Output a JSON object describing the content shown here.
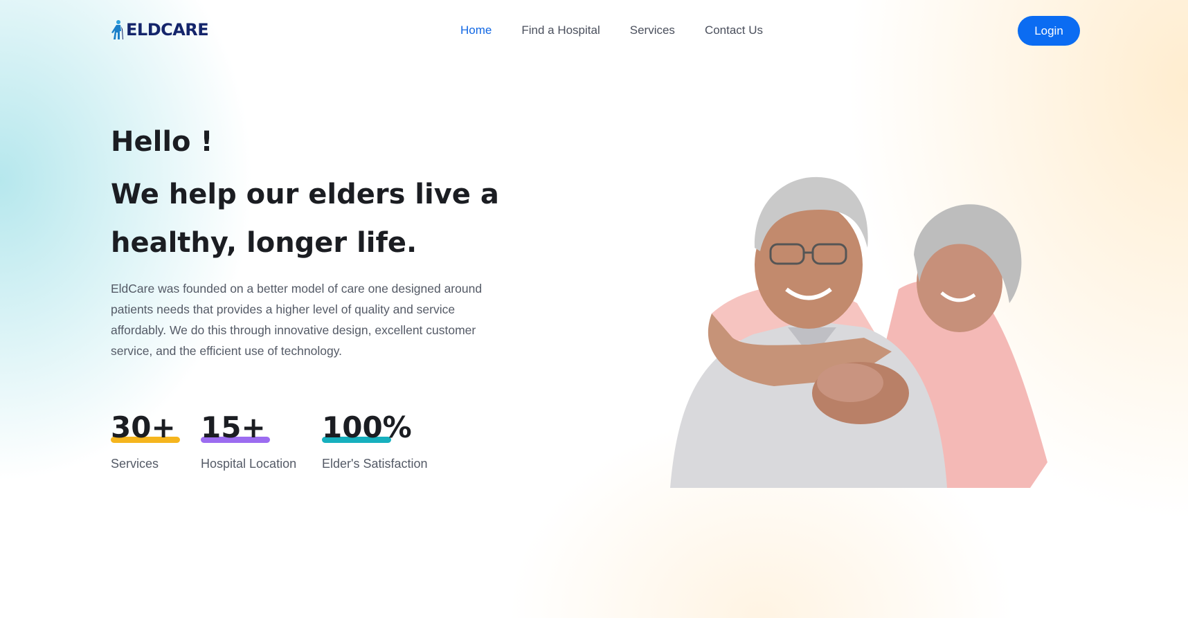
{
  "brand": {
    "name": "ELDCARE"
  },
  "nav": {
    "items": [
      {
        "label": "Home",
        "active": true
      },
      {
        "label": "Find a Hospital",
        "active": false
      },
      {
        "label": "Services",
        "active": false
      },
      {
        "label": "Contact Us",
        "active": false
      }
    ],
    "login_label": "Login"
  },
  "hero": {
    "greeting": "Hello !",
    "title": "We help our elders live a healthy, longer life.",
    "description": "EldCare was founded on a better model of care one designed around patients needs that provides a higher level of quality and service affordably. We do this through innovative design, excellent customer service, and the efficient use of technology."
  },
  "stats": [
    {
      "value": "30+",
      "label": "Services",
      "bar_color": "#f5b51e"
    },
    {
      "value": "15+",
      "label": "Hospital Location",
      "bar_color": "#9c6cf0"
    },
    {
      "value": "100%",
      "label": "Elder's Satisfaction",
      "bar_color": "#17b0be"
    }
  ],
  "colors": {
    "accent": "#0b6cf2",
    "brand_navy": "#14256b",
    "heading": "#1b1d22"
  },
  "icons": {
    "logo": "walking-person-icon"
  }
}
